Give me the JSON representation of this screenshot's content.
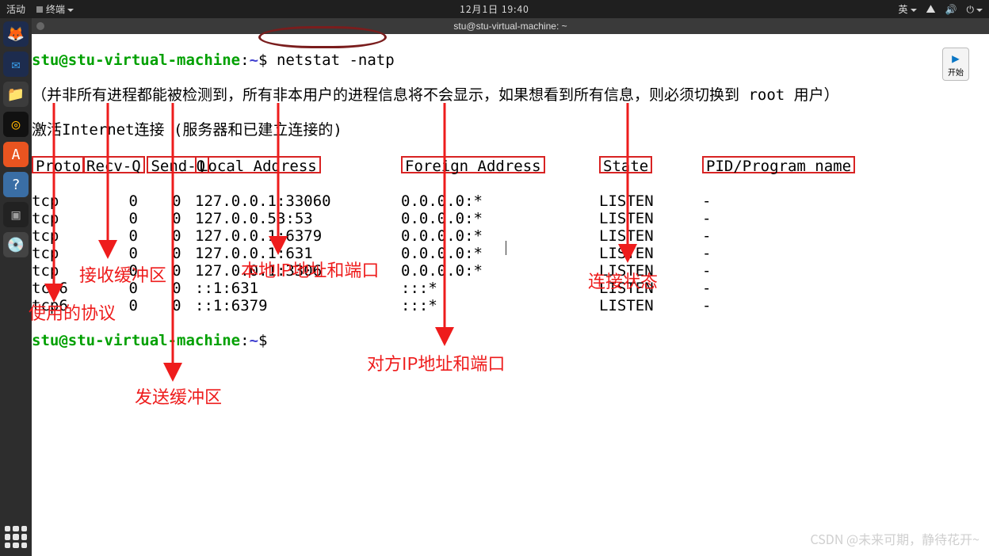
{
  "topbar": {
    "activities": "活动",
    "app": "终端",
    "clock": "12月1日 19:40",
    "lang": "英"
  },
  "window": {
    "title": "stu@stu-virtual-machine: ~"
  },
  "prompt": {
    "user": "stu",
    "host": "stu-virtual-machine",
    "path": "~",
    "symbol": "$"
  },
  "command": "netstat -natp",
  "warning": "（并非所有进程都能被检测到，所有非本用户的进程信息将不会显示，如果想看到所有信息，则必须切换到 root 用户）",
  "title_line": "激活Internet连接 (服务器和已建立连接的)",
  "headers": {
    "proto": "Proto",
    "recvq": "Recv-Q",
    "sendq": "Send-Q",
    "local": "Local Address",
    "foreign": "Foreign Address",
    "state": "State",
    "pid": "PID/Program name"
  },
  "rows": [
    {
      "proto": "tcp",
      "recv": "0",
      "send": "0",
      "local": "127.0.0.1:33060",
      "foreign": "0.0.0.0:*",
      "state": "LISTEN",
      "pid": "-"
    },
    {
      "proto": "tcp",
      "recv": "0",
      "send": "0",
      "local": "127.0.0.53:53",
      "foreign": "0.0.0.0:*",
      "state": "LISTEN",
      "pid": "-"
    },
    {
      "proto": "tcp",
      "recv": "0",
      "send": "0",
      "local": "127.0.0.1:6379",
      "foreign": "0.0.0.0:*",
      "state": "LISTEN",
      "pid": "-"
    },
    {
      "proto": "tcp",
      "recv": "0",
      "send": "0",
      "local": "127.0.0.1:631",
      "foreign": "0.0.0.0:*",
      "state": "LISTEN",
      "pid": "-"
    },
    {
      "proto": "tcp",
      "recv": "0",
      "send": "0",
      "local": "127.0.0.1:3306",
      "foreign": "0.0.0.0:*",
      "state": "LISTEN",
      "pid": "-"
    },
    {
      "proto": "tcp6",
      "recv": "0",
      "send": "0",
      "local": "::1:631",
      "foreign": ":::*",
      "state": "LISTEN",
      "pid": "-"
    },
    {
      "proto": "tcp6",
      "recv": "0",
      "send": "0",
      "local": "::1:6379",
      "foreign": ":::*",
      "state": "LISTEN",
      "pid": "-"
    }
  ],
  "anno": {
    "proto": "使用的协议",
    "recv": "接收缓冲区",
    "send": "发送缓冲区",
    "local": "本地IP地址和端口",
    "foreign": "对方IP地址和端口",
    "state": "连接状态"
  },
  "startbtn": "开始",
  "watermark": "CSDN @未来可期，静待花开~"
}
